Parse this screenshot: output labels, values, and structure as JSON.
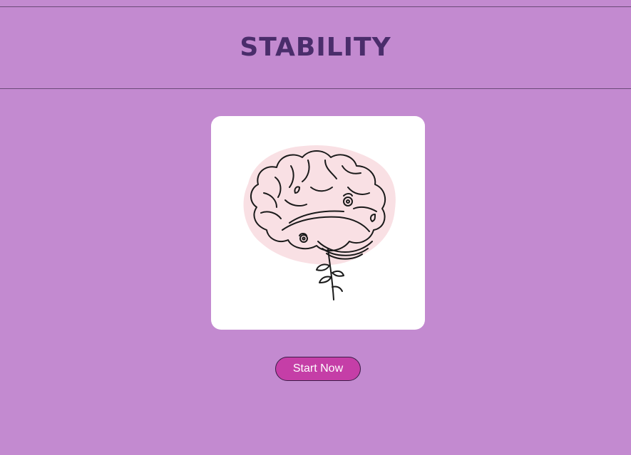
{
  "header": {
    "title": "STABILITY"
  },
  "illustration": {
    "icon": "brain-icon",
    "fill_color": "#f9e0e4",
    "line_color": "#1a1a1a"
  },
  "actions": {
    "start_label": "Start Now"
  },
  "colors": {
    "background": "#c38ad0",
    "title": "#4a2d6b",
    "button": "#c53ea7"
  }
}
